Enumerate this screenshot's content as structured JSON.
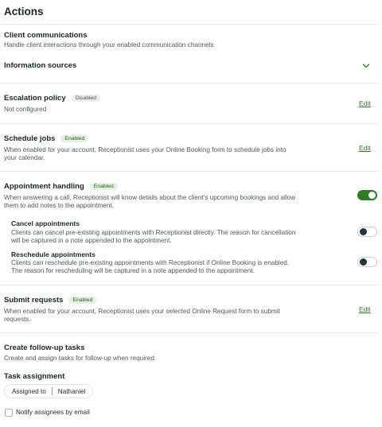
{
  "page": {
    "title": "Actions"
  },
  "client_comms": {
    "title": "Client communications",
    "description": "Handle client interactions through your enabled communication channels"
  },
  "info_sources": {
    "title": "Information sources",
    "icon": "chevron-down-icon"
  },
  "escalation": {
    "title": "Escalation policy",
    "badge": "Disabled",
    "status": "Not configured",
    "edit_label": "Edit"
  },
  "schedule_jobs": {
    "title": "Schedule jobs",
    "badge": "Enabled",
    "description": "When enabled for your account, Receptionist uses your Online Booking form to schedule jobs into your calendar.",
    "edit_label": "Edit"
  },
  "appointment_handling": {
    "title": "Appointment handling",
    "badge": "Enabled",
    "description": "When answering a call, Receptionist will know details about the client's upcoming bookings and allow them to add notes to the appointment.",
    "enabled": true,
    "cancel": {
      "title": "Cancel appointments",
      "description": "Clients can cancel pre-existing appointments with Receptionist directly. The reason for cancellation will be captured in a note appended to the appointment.",
      "enabled": false
    },
    "reschedule": {
      "title": "Reschedule appointments",
      "description": "Clients can reschedule pre-existing appointments with Receptionist if Online Booking is enabled. The reason for rescheduling will be captured in a note appended to the appointment.",
      "enabled": false
    }
  },
  "submit_requests": {
    "title": "Submit requests",
    "badge": "Enabled",
    "description": "When enabled for your account, Receptionist uses your selected Online Request form to submit requests.",
    "edit_label": "Edit"
  },
  "followup": {
    "title": "Create follow-up tasks",
    "description": "Create and assign tasks for follow-up when required."
  },
  "task_assignment": {
    "title": "Task assignment",
    "assigned_label": "Assigned to",
    "assignee": "Nathaniel",
    "notify_label": "Notify assignees by email",
    "notify_checked": false
  },
  "colors": {
    "accent": "#2e7d24",
    "badge_enabled_bg": "#e4f2e0",
    "badge_disabled_bg": "#eceeef"
  }
}
